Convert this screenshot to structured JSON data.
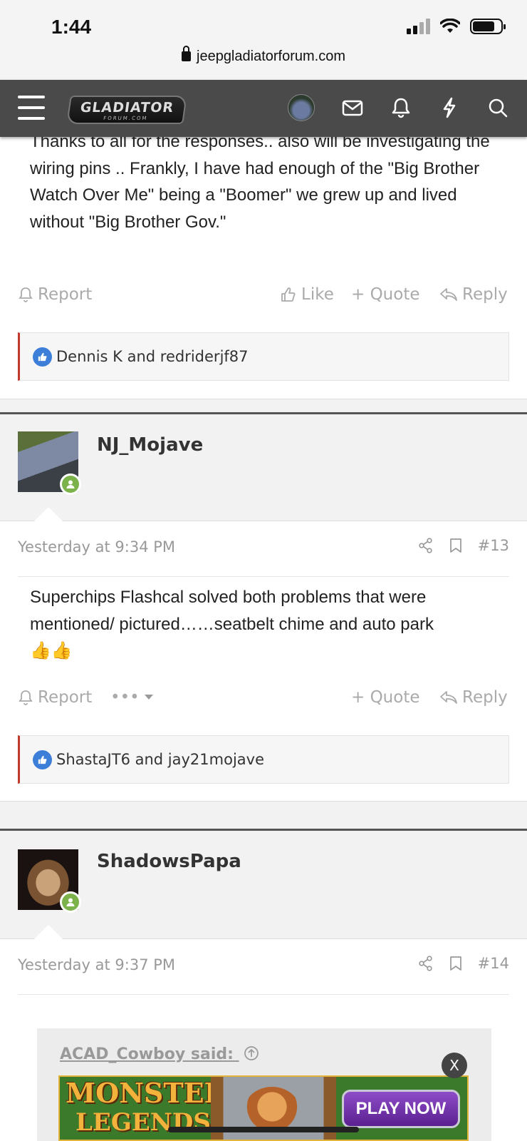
{
  "status_bar": {
    "time": "1:44",
    "url": "jeepgladiatorforum.com"
  },
  "header": {
    "logo_line1": "GLADIATOR",
    "logo_line2": "FORUM.COM"
  },
  "post_prev": {
    "message": "Thanks to all for the responses.. also will be investigating the wiring pins .. Frankly, I have had enough of the \"Big Brother Watch Over Me\" being a \"Boomer\" we grew up and lived without \"Big Brother Gov.\"",
    "actions": {
      "report": "Report",
      "like": "Like",
      "quote": "+ Quote",
      "reply": "Reply"
    },
    "reactions": "Dennis K and redriderjf87"
  },
  "post13": {
    "username": "NJ_Mojave",
    "date": "Yesterday at 9:34 PM",
    "number": "#13",
    "message": "Superchips Flashcal solved both problems that were mentioned/ pictured……seatbelt chime and auto park",
    "emoji": "👍👍",
    "actions": {
      "report": "Report",
      "more": "•••",
      "quote": "+ Quote",
      "reply": "Reply"
    },
    "reactions": "ShastaJT6 and jay21mojave"
  },
  "post14": {
    "username": "ShadowsPapa",
    "date": "Yesterday at 9:37 PM",
    "number": "#14",
    "quote_author": "ACAD_Cowboy said:"
  },
  "ad": {
    "title_line1": "MONSTER",
    "title_line2": "LEGENDS",
    "cta": "PLAY NOW",
    "close": "X"
  }
}
